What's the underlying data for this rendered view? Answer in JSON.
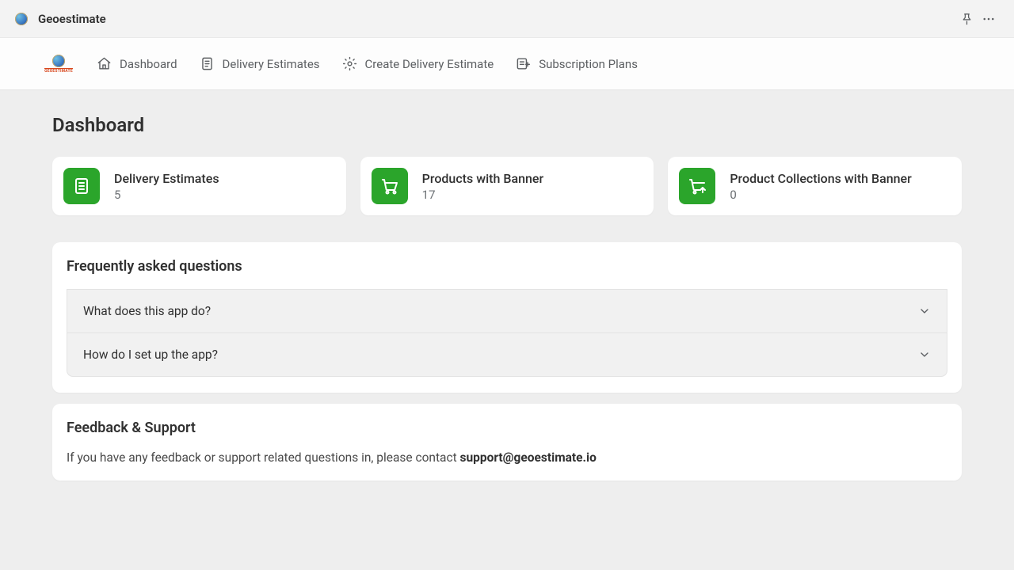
{
  "topbar": {
    "title": "Geoestimate"
  },
  "nav": {
    "logo_text": "GEOESTIMATE",
    "items": [
      {
        "label": "Dashboard"
      },
      {
        "label": "Delivery Estimates"
      },
      {
        "label": "Create Delivery Estimate"
      },
      {
        "label": "Subscription Plans"
      }
    ]
  },
  "page": {
    "title": "Dashboard"
  },
  "stats": [
    {
      "label": "Delivery Estimates",
      "value": "5"
    },
    {
      "label": "Products with Banner",
      "value": "17"
    },
    {
      "label": "Product Collections with Banner",
      "value": "0"
    }
  ],
  "faq": {
    "title": "Frequently asked questions",
    "items": [
      {
        "question": "What does this app do?"
      },
      {
        "question": "How do I set up the app?"
      }
    ]
  },
  "support": {
    "title": "Feedback & Support",
    "text_prefix": "If you have any feedback or support related questions in, please contact ",
    "email": "support@geoestimate.io"
  }
}
